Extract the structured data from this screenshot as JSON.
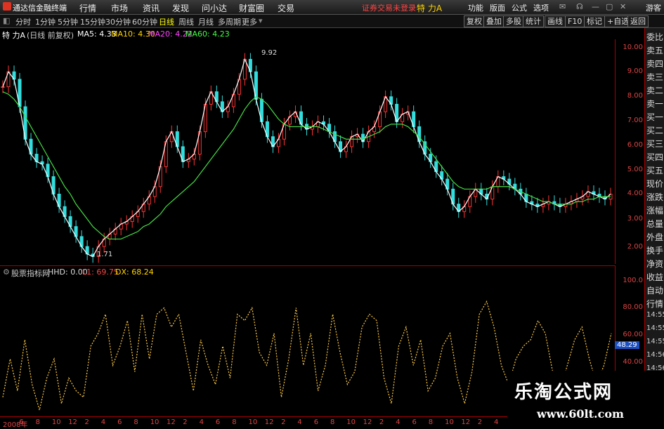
{
  "app": {
    "title": "通达信金融终端"
  },
  "menu": [
    "行情",
    "市场",
    "资讯",
    "发现",
    "问小达",
    "财富圈",
    "交易"
  ],
  "login_status": "证券交易未登录",
  "stock_title": "特 力A",
  "right_menu": [
    "功能",
    "版面",
    "公式",
    "选项"
  ],
  "guest": "游客",
  "periods": [
    "分时",
    "1分钟",
    "5分钟",
    "15分钟",
    "30分钟",
    "60分钟",
    "日线",
    "周线",
    "月线",
    "多周期",
    "更多"
  ],
  "active_period": "日线",
  "tool_buttons": [
    "复权",
    "叠加",
    "多股",
    "统计",
    "画线",
    "F10",
    "标记",
    "+自选",
    "返回"
  ],
  "info": {
    "name": "特 力A",
    "mode": "(日线 前复权)",
    "ma5": "MA5: 4.33",
    "ma10": "MA10: 4.30",
    "ma20": "MA20: 4.22",
    "ma60": "MA60: 4.23",
    "colors": {
      "ma5": "#ffffff",
      "ma10": "#ffd400",
      "ma20": "#ff44ff",
      "ma60": "#44ff44"
    }
  },
  "main_axis": [
    "10.00",
    "9.00",
    "8.00",
    "7.00",
    "6.00",
    "5.00",
    "4.00",
    "3.00",
    "2.00"
  ],
  "annotations": {
    "high": "9.92",
    "low": "1.71"
  },
  "sub": {
    "name": "股票指标网",
    "hhd": "HHD: 0.00",
    "l1": "L1: 69.75",
    "dx": "DX: 68.24"
  },
  "sub_axis": [
    "100.0",
    "80.00",
    "60.00",
    "40.00"
  ],
  "sub_current": "48.29",
  "x_axis": [
    "2008年",
    "6",
    "8",
    "10",
    "12",
    "2",
    "4",
    "6",
    "8",
    "10",
    "12",
    "2",
    "4",
    "6",
    "8",
    "10",
    "12",
    "2",
    "4",
    "6",
    "8",
    "10",
    "12",
    "2",
    "4",
    "6",
    "8",
    "10",
    "12",
    "2",
    "4",
    "6",
    "8",
    "10",
    "12",
    "2",
    "4",
    "6"
  ],
  "side_panel": [
    "委比",
    "卖五",
    "卖四",
    "卖三",
    "卖二",
    "卖一",
    "买一",
    "买二",
    "买三",
    "买四",
    "买五",
    "现价",
    "涨跌",
    "涨幅",
    "总量",
    "外盘",
    "换手",
    "净资",
    "收益",
    "自动",
    "行情",
    "14:55",
    "14:55",
    "14:55",
    "14:56",
    "14:56",
    "14:56",
    "14:56",
    "14:56"
  ],
  "watermark": {
    "cn": "乐淘公式网",
    "url": "www.60lt.com"
  },
  "chart_data": {
    "type": "line",
    "title": "特 力A (日线 前复权)",
    "ylim": [
      1.5,
      10.5
    ],
    "close": [
      8.6,
      9.2,
      8.9,
      7.8,
      6.5,
      5.9,
      5.6,
      5.5,
      5.0,
      4.3,
      3.8,
      3.4,
      3.0,
      2.6,
      2.2,
      1.9,
      1.8,
      2.2,
      2.5,
      2.7,
      2.9,
      3.1,
      3.2,
      3.4,
      3.6,
      3.9,
      4.2,
      4.6,
      5.4,
      6.4,
      6.8,
      6.2,
      5.6,
      5.7,
      5.9,
      6.8,
      7.9,
      8.4,
      8.0,
      7.6,
      7.8,
      8.3,
      8.9,
      9.7,
      9.2,
      8.1,
      7.2,
      6.6,
      6.2,
      6.5,
      7.1,
      7.4,
      7.6,
      7.1,
      6.9,
      7.0,
      7.2,
      7.1,
      6.8,
      6.4,
      6.0,
      6.2,
      6.6,
      6.7,
      6.4,
      6.8,
      7.0,
      7.6,
      8.2,
      7.9,
      7.2,
      7.5,
      7.6,
      7.0,
      6.4,
      5.9,
      5.6,
      5.2,
      4.9,
      4.5,
      3.9,
      3.6,
      3.8,
      4.2,
      4.5,
      4.3,
      4.1,
      4.6,
      5.0,
      4.9,
      4.7,
      4.5,
      4.3,
      4.0,
      3.9,
      3.8,
      3.9,
      4.0,
      3.9,
      3.8,
      3.9,
      4.0,
      4.1,
      4.2,
      4.4,
      4.3,
      4.2,
      4.1,
      4.3
    ],
    "ma60": [
      8.4,
      8.3,
      8.1,
      7.8,
      7.4,
      7.0,
      6.6,
      6.2,
      5.8,
      5.4,
      5.0,
      4.6,
      4.3,
      3.9,
      3.6,
      3.3,
      3.0,
      2.8,
      2.6,
      2.5,
      2.5,
      2.5,
      2.6,
      2.7,
      2.8,
      3.0,
      3.1,
      3.3,
      3.5,
      3.8,
      4.0,
      4.2,
      4.4,
      4.6,
      4.8,
      5.1,
      5.4,
      5.7,
      6.0,
      6.3,
      6.6,
      6.9,
      7.3,
      7.7,
      8.0,
      8.2,
      8.1,
      7.9,
      7.6,
      7.3,
      7.1,
      7.0,
      7.0,
      7.0,
      7.0,
      7.0,
      7.0,
      6.9,
      6.8,
      6.7,
      6.6,
      6.5,
      6.5,
      6.5,
      6.5,
      6.6,
      6.7,
      6.8,
      7.0,
      7.1,
      7.1,
      7.1,
      7.0,
      6.8,
      6.6,
      6.3,
      6.0,
      5.7,
      5.4,
      5.1,
      4.8,
      4.6,
      4.5,
      4.5,
      4.5,
      4.5,
      4.5,
      4.6,
      4.6,
      4.6,
      4.6,
      4.5,
      4.4,
      4.3,
      4.2,
      4.1,
      4.0,
      4.0,
      3.9,
      3.9,
      3.9,
      3.9,
      4.0,
      4.0,
      4.1,
      4.1,
      4.2,
      4.2,
      4.2
    ],
    "indicator": {
      "name": "股票指标网",
      "ylim": [
        0,
        110
      ],
      "values": [
        15,
        45,
        20,
        60,
        25,
        5,
        30,
        45,
        10,
        30,
        20,
        15,
        55,
        65,
        80,
        40,
        55,
        75,
        35,
        80,
        45,
        80,
        85,
        70,
        80,
        50,
        20,
        60,
        40,
        25,
        55,
        30,
        80,
        75,
        85,
        50,
        40,
        65,
        15,
        45,
        85,
        40,
        65,
        20,
        40,
        80,
        50,
        25,
        35,
        70,
        80,
        75,
        30,
        10,
        55,
        70,
        40,
        60,
        20,
        30,
        55,
        65,
        30,
        10,
        35,
        80,
        90,
        70,
        40,
        25,
        45,
        55,
        60,
        75,
        65,
        35,
        20,
        40,
        60,
        70,
        45,
        25,
        40,
        65
      ]
    }
  }
}
